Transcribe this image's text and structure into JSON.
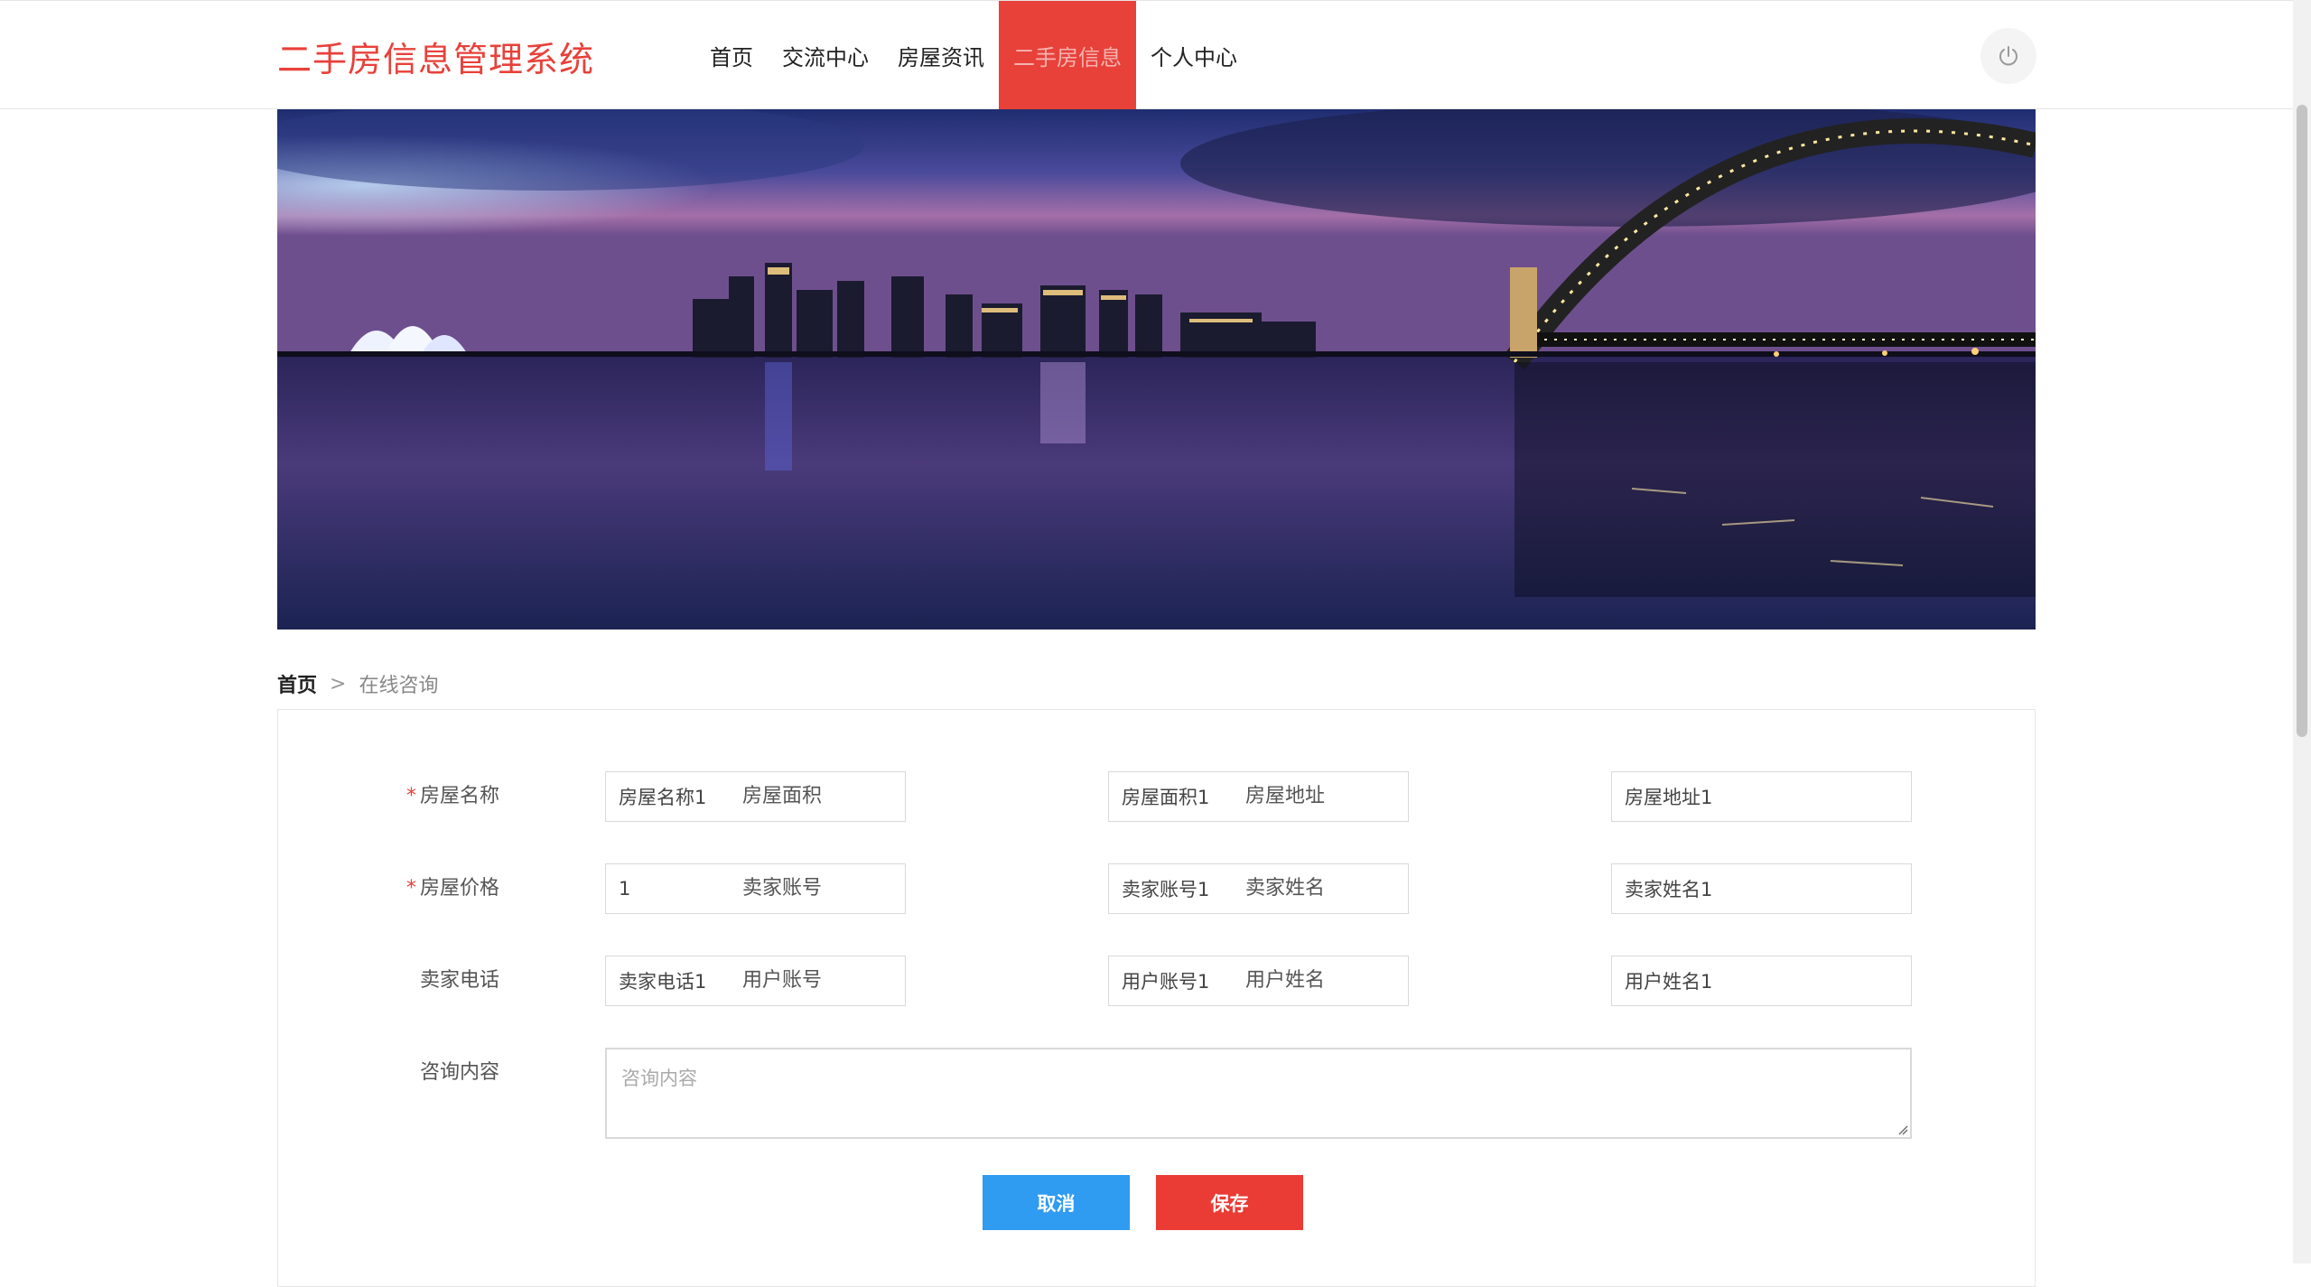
{
  "header": {
    "brand": "二手房信息管理系统",
    "nav": [
      {
        "label": "首页",
        "active": false
      },
      {
        "label": "交流中心",
        "active": false
      },
      {
        "label": "房屋资讯",
        "active": false
      },
      {
        "label": "二手房信息",
        "active": true
      },
      {
        "label": "个人中心",
        "active": false
      }
    ],
    "power_icon": "power-icon"
  },
  "breadcrumb": {
    "home": "首页",
    "separator": ">",
    "current": "在线咨询"
  },
  "form": {
    "fields": [
      {
        "label": "房屋名称",
        "required": true,
        "value": "房屋名称1"
      },
      {
        "label": "房屋面积",
        "required": false,
        "value": "房屋面积1"
      },
      {
        "label": "房屋地址",
        "required": false,
        "value": "房屋地址1"
      },
      {
        "label": "房屋价格",
        "required": true,
        "value": "1"
      },
      {
        "label": "卖家账号",
        "required": false,
        "value": "卖家账号1"
      },
      {
        "label": "卖家姓名",
        "required": false,
        "value": "卖家姓名1"
      },
      {
        "label": "卖家电话",
        "required": false,
        "value": "卖家电话1"
      },
      {
        "label": "用户账号",
        "required": false,
        "value": "用户账号1"
      },
      {
        "label": "用户姓名",
        "required": false,
        "value": "用户姓名1"
      }
    ],
    "content": {
      "label": "咨询内容",
      "placeholder": "咨询内容",
      "value": ""
    },
    "required_mark": "*",
    "cancel_label": "取消",
    "save_label": "保存"
  },
  "colors": {
    "brand": "#e8413a",
    "cancel": "#2f9bf1",
    "save": "#ea3b35"
  }
}
